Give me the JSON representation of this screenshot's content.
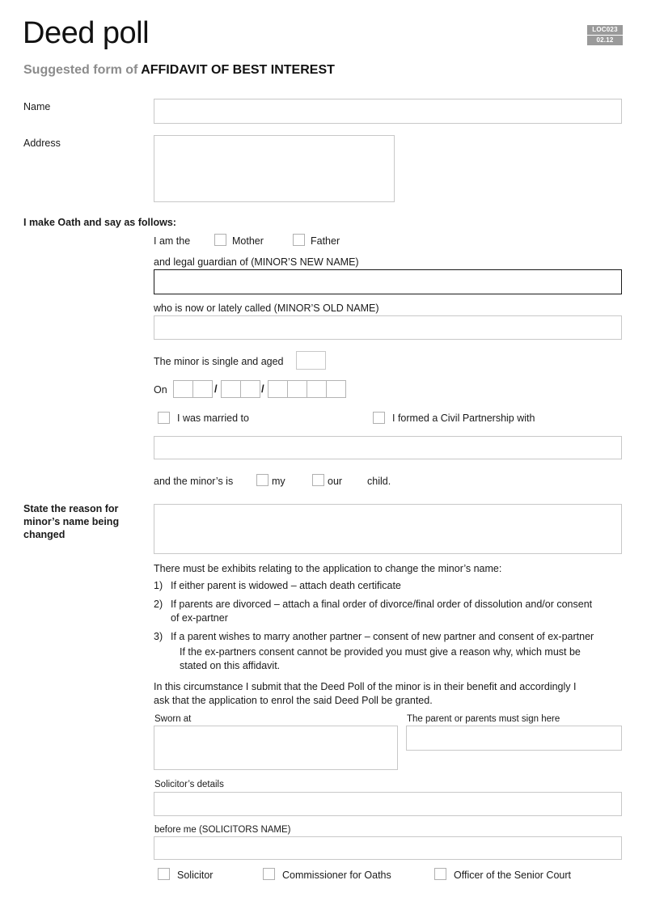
{
  "header": {
    "title": "Deed poll",
    "subtitle_muted": "Suggested form of ",
    "subtitle_strong": "AFFIDAVIT OF BEST INTEREST",
    "form_code": "LOC023",
    "form_version": "02.12"
  },
  "applicant": {
    "name_label": "Name",
    "name_value": "",
    "address_label": "Address",
    "address_value": ""
  },
  "oath": {
    "heading": "I make Oath and say as follows:",
    "i_am_the_label": "I am the",
    "role_options": [
      {
        "label": "Mother",
        "checked": false
      },
      {
        "label": "Father",
        "checked": false
      }
    ],
    "new_name_caption_plain": "and legal guardian of (MINOR’S ",
    "new_name_caption_bold": "NEW NAME",
    "new_name_caption_tail": ")",
    "new_name_value": "",
    "old_name_caption_plain": "who is now or lately called (MINOR’S ",
    "old_name_caption_bold": "OLD NAME",
    "old_name_caption_tail": ")",
    "old_name_value": "",
    "age_label": "The minor is single and aged",
    "age_value": "",
    "on_label": "On",
    "date_day": [
      "",
      ""
    ],
    "date_month": [
      "",
      ""
    ],
    "date_year": [
      "",
      "",
      "",
      ""
    ],
    "date_separator": "/",
    "relationship_options": [
      {
        "label": "I was married to",
        "checked": false
      },
      {
        "label": "I formed a Civil Partnership with",
        "checked": false
      }
    ],
    "partner_name_value": "",
    "minor_is_label": "and the minor’s is",
    "possessive_options": [
      {
        "label": "my",
        "checked": false
      },
      {
        "label": "our",
        "checked": false
      }
    ],
    "child_label": "child."
  },
  "reason": {
    "label_line1": "State the reason for",
    "label_line2": "minor’s name being",
    "label_line3": "changed",
    "value": ""
  },
  "exhibits": {
    "intro": "There must be exhibits relating to the application to change the minor’s name:",
    "items": [
      {
        "number": "1)",
        "lines": [
          "If either parent is widowed – attach death certificate"
        ]
      },
      {
        "number": "2)",
        "lines": [
          "If parents are divorced – attach a final order of divorce/final order of dissolution and/or consent",
          "of ex-partner"
        ]
      },
      {
        "number": "3)",
        "lines": [
          "If a parent wishes to marry another partner – consent of new partner and consent of ex-partner"
        ]
      }
    ],
    "note_lines": [
      "If the ex-partners consent cannot be provided you must give a reason why, which must be",
      "stated on this affidavit."
    ],
    "closing_lines": [
      "In this circumstance I submit that the Deed Poll of the minor is in their benefit and accordingly I",
      "ask that the application to enrol the said Deed Poll be granted."
    ]
  },
  "execution": {
    "sworn_at_label": "Sworn at",
    "sworn_at_value": "",
    "signature_label": "The parent or parents must sign here",
    "signature_value": "",
    "solicitor_details_label": "Solicitor’s details",
    "solicitor_details_value": "",
    "before_me_label": "before me (SOLICITORS NAME)",
    "before_me_value": "",
    "capacity_options": [
      {
        "label": "Solicitor",
        "checked": false
      },
      {
        "label": "Commissioner for Oaths",
        "checked": false
      },
      {
        "label": "Officer of the Senior Court",
        "checked": false
      }
    ]
  },
  "colors": {
    "badge_background": "#9a9a9a",
    "field_border": "#c8c8c8",
    "emphasis_border": "#1a1a1a",
    "muted_text": "#8c8c8c",
    "text": "#1a1a1a"
  }
}
